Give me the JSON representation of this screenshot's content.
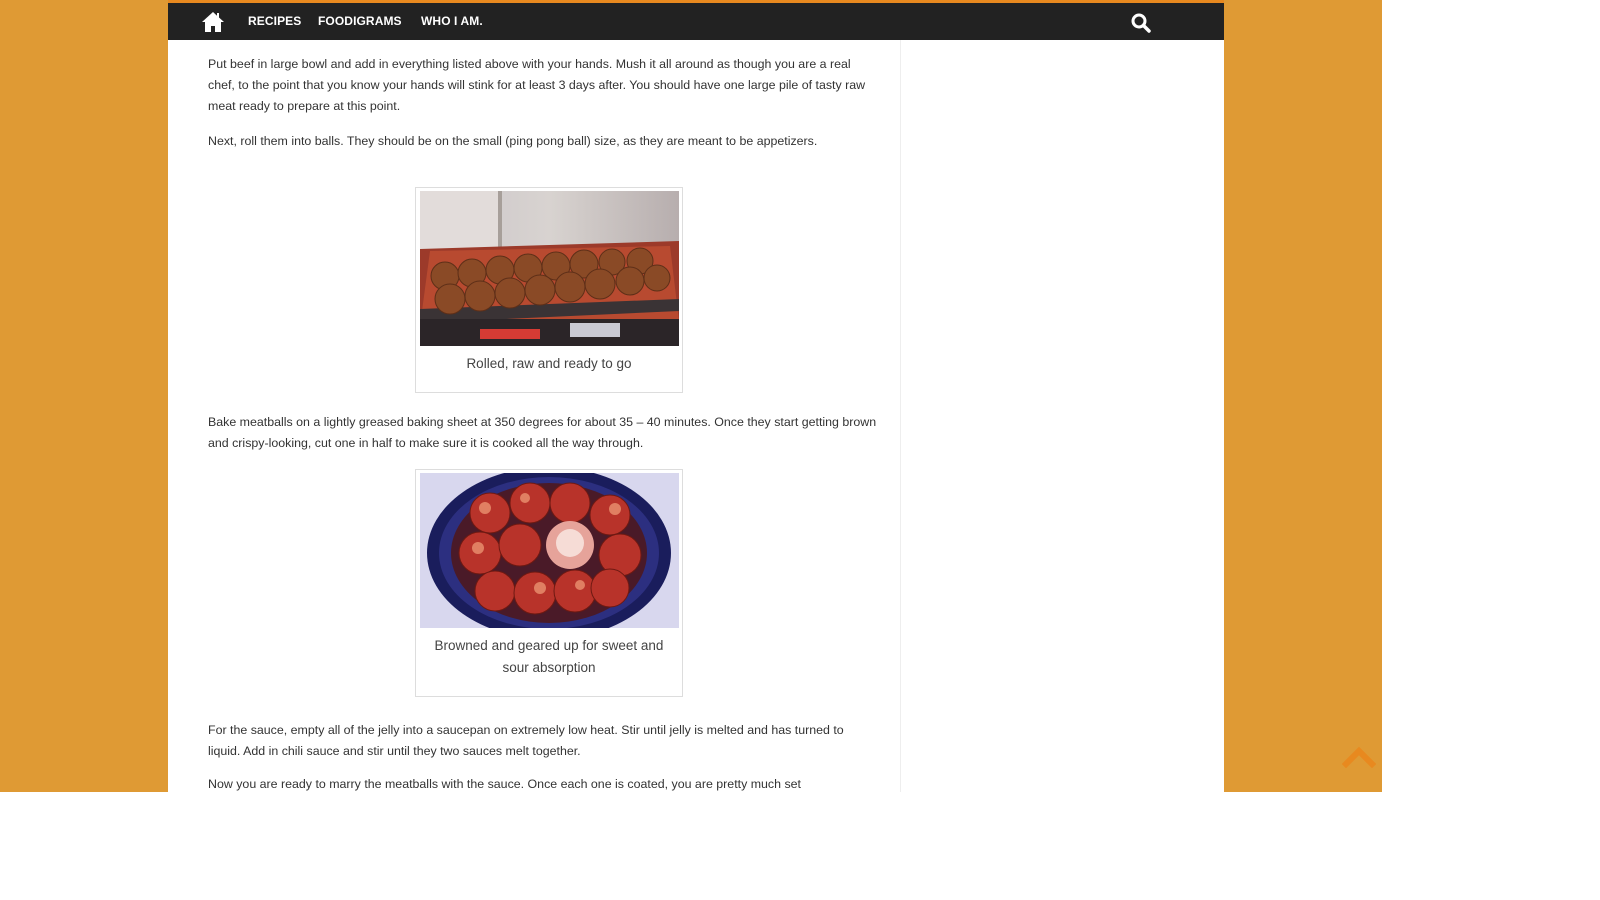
{
  "nav": {
    "home_icon": "home-icon",
    "items": [
      {
        "label": "RECIPES"
      },
      {
        "label": "FOODIGRAMS"
      },
      {
        "label": "WHO I AM."
      }
    ],
    "search_icon": "search-icon"
  },
  "article": {
    "para1": "Put beef in large bowl and add in everything listed above with your hands. Mush it all around as though you are a real chef, to the point that you know your hands will stink for at least 3 days after. You should have one large pile of tasty raw meat ready to prepare at this point.",
    "para2": "Next, roll them into balls. They should be on the small (ping pong ball) size, as they are meant to be appetizers.",
    "figure1_caption": "Rolled, raw and ready to go",
    "para3": "Bake meatballs on a lightly greased baking sheet at 350 degrees for about 35 – 40 minutes. Once they start getting brown and crispy-looking, cut one in half to make sure it is cooked all the way through.",
    "figure2_caption": "Browned and geared up for sweet and sour absorption",
    "para4": "For the sauce, empty all of the jelly into a saucepan on extremely low heat. Stir until jelly is melted and has turned to liquid. Add in chili sauce and stir until they two sauces melt together.",
    "para5": "Now you are ready to marry the meatballs with the sauce. Once each one is coated, you are pretty much set"
  },
  "colors": {
    "background": "#df9a34",
    "navbar": "#222222",
    "accent": "#e8891f"
  }
}
